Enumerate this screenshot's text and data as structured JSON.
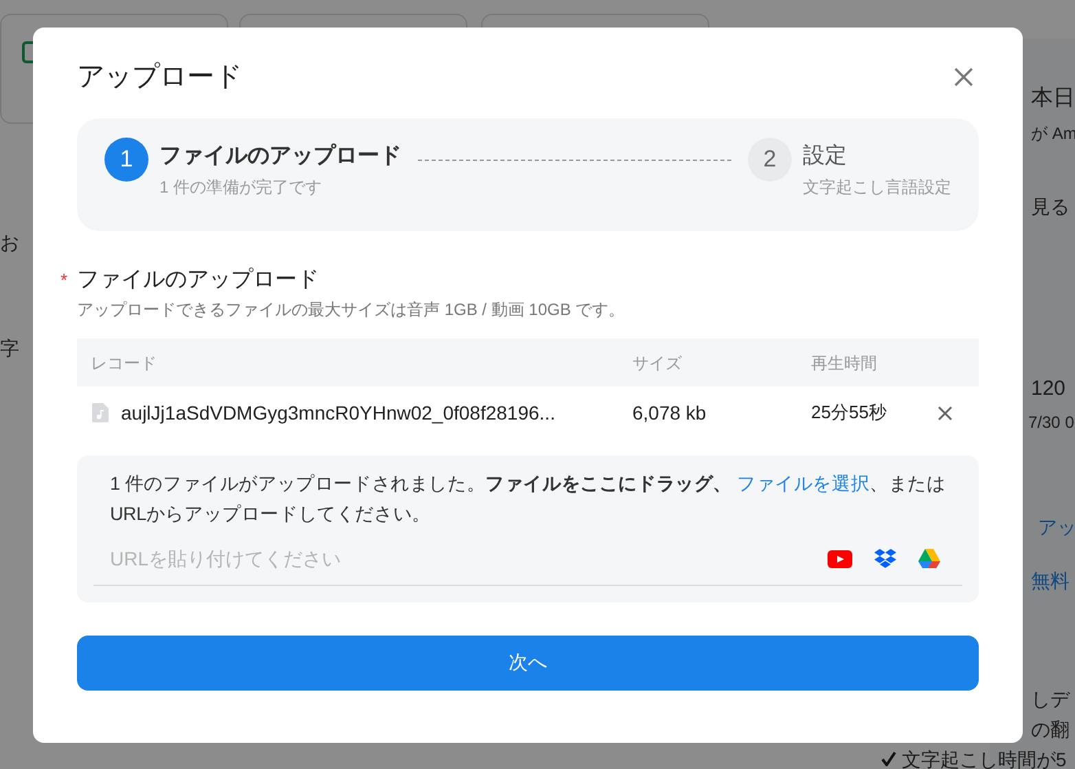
{
  "background": {
    "sidebar_texts": [
      "お",
      "字"
    ],
    "right_panel": {
      "title": "本日",
      "subtitle": "が Am",
      "view_button": "見る",
      "minutes": "120",
      "date": "7/30 0",
      "action_link": "アッ",
      "trial_link": "無料",
      "features": [
        "しデ",
        "の翻",
        "文字起こし時間が5"
      ]
    }
  },
  "dialog": {
    "title": "アップロード",
    "steps": [
      {
        "number": "1",
        "title": "ファイルのアップロード",
        "subtitle": "1 件の準備が完了です",
        "selected": true
      },
      {
        "number": "2",
        "title": "設定",
        "subtitle": "文字起こし言語設定",
        "selected": false
      }
    ],
    "section": {
      "title": "ファイルのアップロード",
      "required_mark": "*",
      "hint": "アップロードできるファイルの最大サイズは音声 1GB / 動画 10GB です。"
    },
    "table": {
      "columns": [
        "レコード",
        "サイズ",
        "再生時間"
      ],
      "rows": [
        {
          "name": "aujlJj1aSdVDMGyg3mncR0YHnw02_0f08f28196...",
          "size": "6,078 kb",
          "duration": "25分55秒"
        }
      ]
    },
    "dropzone": {
      "text_before": "1 件のファイルがアップロードされました。**ファイルをここにドラッグ、** ",
      "link": "ファイルを選択",
      "text_after": "、またはURLからアップロードしてください。",
      "url_field": {
        "placeholder": "URLを貼り付けてください"
      }
    },
    "next_button": "次へ"
  }
}
